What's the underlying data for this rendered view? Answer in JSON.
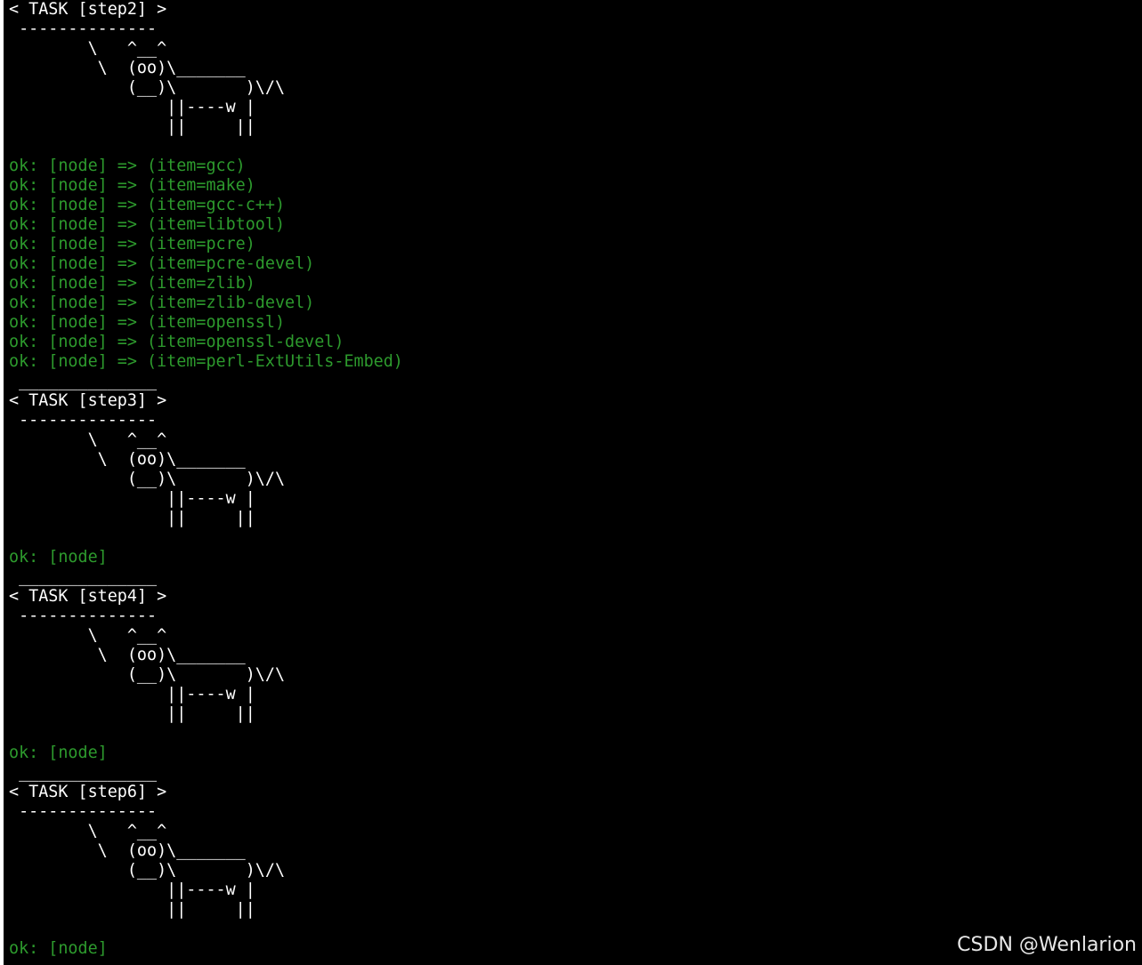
{
  "terminal": {
    "colors": {
      "background": "#000000",
      "banner_text": "#ffffff",
      "ok_text": "#2d9a2d"
    },
    "lines": [
      {
        "text": "< TASK [step2] >",
        "color": "white"
      },
      {
        "text": " --------------",
        "color": "white"
      },
      {
        "text": "        \\   ^__^",
        "color": "white"
      },
      {
        "text": "         \\  (oo)\\_______",
        "color": "white"
      },
      {
        "text": "            (__)\\       )\\/\\",
        "color": "white"
      },
      {
        "text": "                ||----w |",
        "color": "white"
      },
      {
        "text": "                ||     ||",
        "color": "white"
      },
      {
        "text": "",
        "color": "white"
      },
      {
        "text": "ok: [node] => (item=gcc)",
        "color": "green"
      },
      {
        "text": "ok: [node] => (item=make)",
        "color": "green"
      },
      {
        "text": "ok: [node] => (item=gcc-c++)",
        "color": "green"
      },
      {
        "text": "ok: [node] => (item=libtool)",
        "color": "green"
      },
      {
        "text": "ok: [node] => (item=pcre)",
        "color": "green"
      },
      {
        "text": "ok: [node] => (item=pcre-devel)",
        "color": "green"
      },
      {
        "text": "ok: [node] => (item=zlib)",
        "color": "green"
      },
      {
        "text": "ok: [node] => (item=zlib-devel)",
        "color": "green"
      },
      {
        "text": "ok: [node] => (item=openssl)",
        "color": "green"
      },
      {
        "text": "ok: [node] => (item=openssl-devel)",
        "color": "green"
      },
      {
        "text": "ok: [node] => (item=perl-ExtUtils-Embed)",
        "color": "green"
      },
      {
        "text": " ______________",
        "color": "white"
      },
      {
        "text": "< TASK [step3] >",
        "color": "white"
      },
      {
        "text": " --------------",
        "color": "white"
      },
      {
        "text": "        \\   ^__^",
        "color": "white"
      },
      {
        "text": "         \\  (oo)\\_______",
        "color": "white"
      },
      {
        "text": "            (__)\\       )\\/\\",
        "color": "white"
      },
      {
        "text": "                ||----w |",
        "color": "white"
      },
      {
        "text": "                ||     ||",
        "color": "white"
      },
      {
        "text": "",
        "color": "white"
      },
      {
        "text": "ok: [node]",
        "color": "green"
      },
      {
        "text": " ______________",
        "color": "white"
      },
      {
        "text": "< TASK [step4] >",
        "color": "white"
      },
      {
        "text": " --------------",
        "color": "white"
      },
      {
        "text": "        \\   ^__^",
        "color": "white"
      },
      {
        "text": "         \\  (oo)\\_______",
        "color": "white"
      },
      {
        "text": "            (__)\\       )\\/\\",
        "color": "white"
      },
      {
        "text": "                ||----w |",
        "color": "white"
      },
      {
        "text": "                ||     ||",
        "color": "white"
      },
      {
        "text": "",
        "color": "white"
      },
      {
        "text": "ok: [node]",
        "color": "green"
      },
      {
        "text": " ______________",
        "color": "white"
      },
      {
        "text": "< TASK [step6] >",
        "color": "white"
      },
      {
        "text": " --------------",
        "color": "white"
      },
      {
        "text": "        \\   ^__^",
        "color": "white"
      },
      {
        "text": "         \\  (oo)\\_______",
        "color": "white"
      },
      {
        "text": "            (__)\\       )\\/\\",
        "color": "white"
      },
      {
        "text": "                ||----w |",
        "color": "white"
      },
      {
        "text": "                ||     ||",
        "color": "white"
      },
      {
        "text": "",
        "color": "white"
      },
      {
        "text": "ok: [node]",
        "color": "green"
      }
    ]
  },
  "watermark": {
    "text": "CSDN @Wenlarion"
  }
}
